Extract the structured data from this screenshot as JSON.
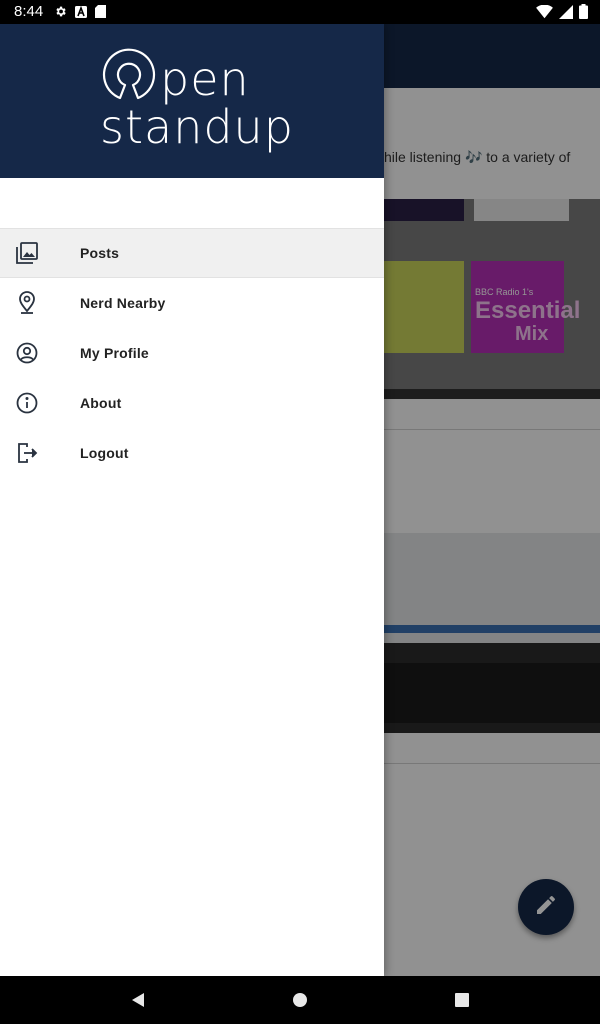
{
  "status_bar": {
    "time": "8:44",
    "left_icons": [
      "gear-icon",
      "a-icon",
      "sd-card-icon"
    ],
    "right_icons": [
      "wifi-icon",
      "cell-signal-icon",
      "battery-icon"
    ]
  },
  "background": {
    "snippet_text": "hile listening 🎶 to a variety of",
    "tiles": [
      "Essential",
      "Mix",
      "BBC Radio 1's"
    ],
    "fab_icon": "pencil-icon"
  },
  "drawer": {
    "logo_line1": "pen",
    "logo_line2": "standup",
    "items": [
      {
        "label": "Posts",
        "icon": "image-gallery-icon",
        "active": true
      },
      {
        "label": "Nerd Nearby",
        "icon": "location-pin-icon",
        "active": false
      },
      {
        "label": "My Profile",
        "icon": "account-circle-icon",
        "active": false
      },
      {
        "label": "About",
        "icon": "info-icon",
        "active": false
      },
      {
        "label": "Logout",
        "icon": "logout-icon",
        "active": false
      }
    ]
  },
  "nav_bar": [
    "back-icon",
    "home-icon",
    "recents-icon"
  ],
  "colors": {
    "primary": "#152848",
    "active_row": "#f0f0f0",
    "icon": "#2a3340"
  }
}
